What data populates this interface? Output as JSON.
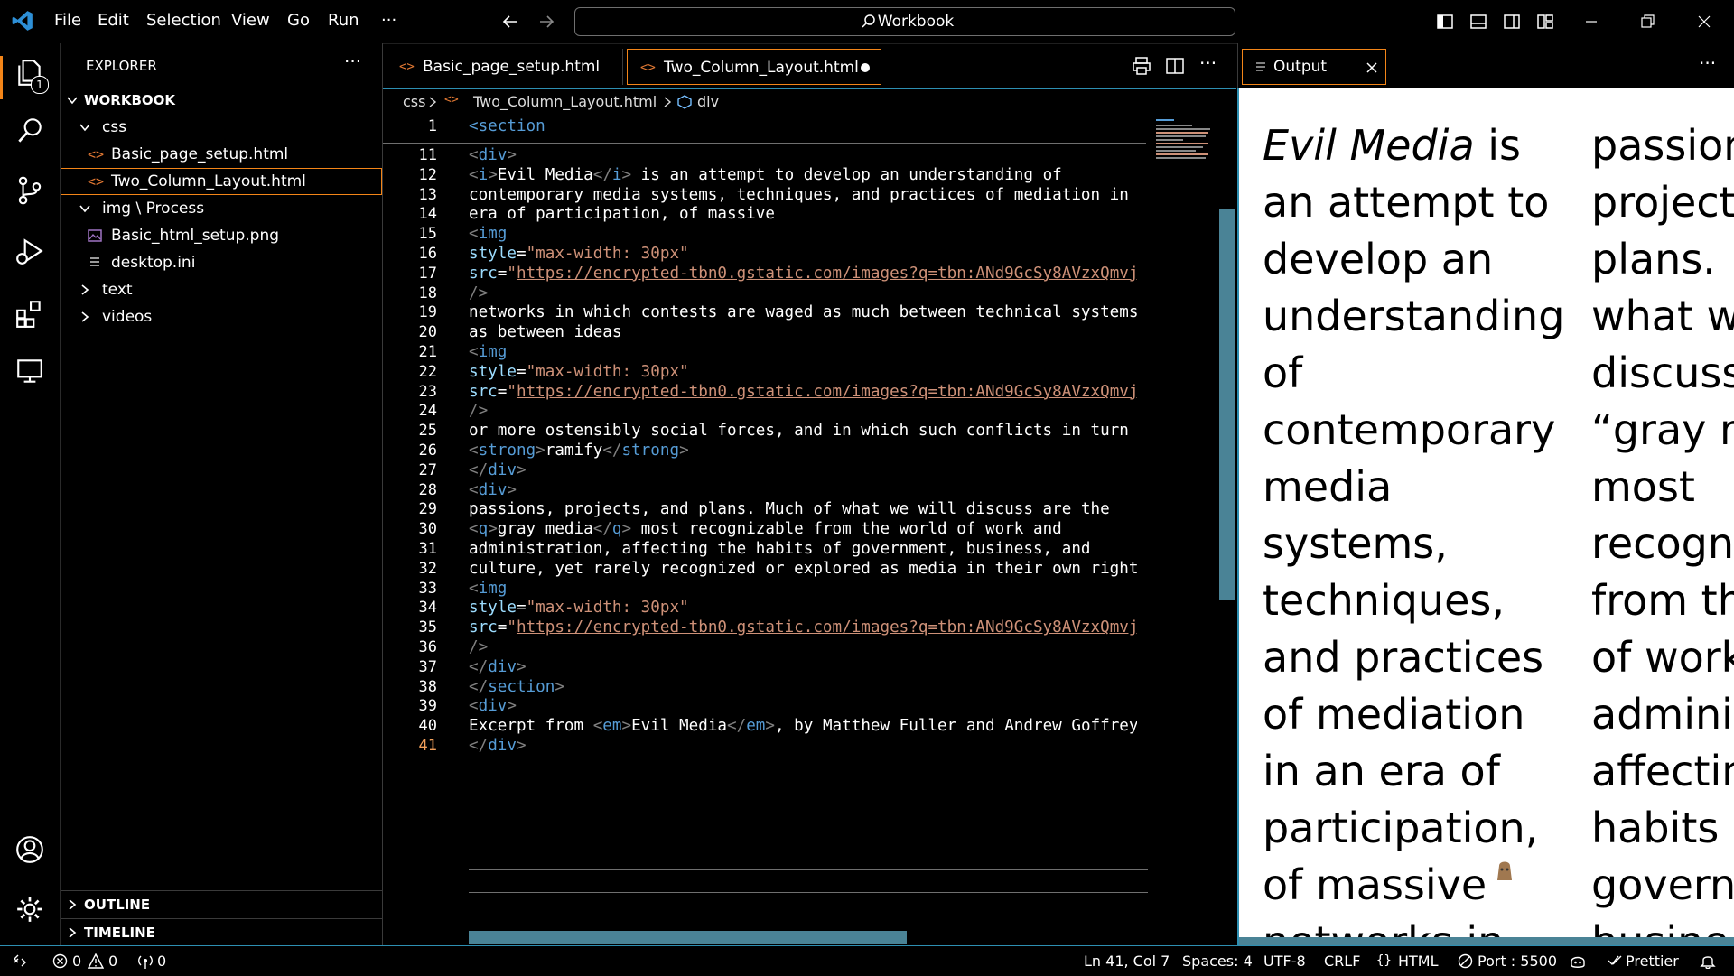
{
  "titlebar": {
    "menu": [
      "File",
      "Edit",
      "Selection",
      "View",
      "Go",
      "Run"
    ],
    "more": "···",
    "search_label": "Workbook"
  },
  "activity": {
    "explorer_badge": "1"
  },
  "sidebar": {
    "title": "EXPLORER",
    "more": "···",
    "workspace": "WORKBOOK",
    "tree": [
      {
        "label": "css",
        "kind": "folder-open",
        "depth": 1
      },
      {
        "label": "Basic_page_setup.html",
        "kind": "html",
        "depth": 2
      },
      {
        "label": "Two_Column_Layout.html",
        "kind": "html",
        "depth": 2,
        "selected": true
      },
      {
        "label": "img \\ Process",
        "kind": "folder-open",
        "depth": 1
      },
      {
        "label": "Basic_html_setup.png",
        "kind": "image",
        "depth": 2
      },
      {
        "label": "desktop.ini",
        "kind": "text-file",
        "depth": 2
      },
      {
        "label": "text",
        "kind": "folder-closed",
        "depth": 1
      },
      {
        "label": "videos",
        "kind": "folder-closed",
        "depth": 1
      }
    ],
    "outline": "OUTLINE",
    "timeline": "TIMELINE"
  },
  "tabs": [
    {
      "label": "Basic_page_setup.html",
      "active": false
    },
    {
      "label": "Two_Column_Layout.html",
      "active": true,
      "modified": true
    }
  ],
  "breadcrumb": [
    "css",
    "Two_Column_Layout.html",
    "div"
  ],
  "output": {
    "tab_label": "Output",
    "col1": [
      "Evil Media is",
      "an attempt to",
      "develop an",
      "understanding",
      "of",
      "contemporary",
      "media",
      "systems,",
      "techniques,",
      "and practices",
      "of mediation",
      "in an era of",
      "participation,",
      "of massive",
      "networks in"
    ],
    "col2": [
      "passion",
      "project",
      "plans.",
      "what w",
      "discuss",
      "“gray m",
      "most",
      "recogn",
      "from th",
      "of work",
      "admini",
      "affectin",
      "habits",
      "govern",
      "busine"
    ]
  },
  "status": {
    "errors": "0",
    "warnings": "0",
    "ports": "0",
    "position": "Ln 41, Col 7",
    "spaces": "Spaces: 4",
    "encoding": "UTF-8",
    "eol": "CRLF",
    "language": "HTML",
    "port": "Port : 5500",
    "prettier": "Prettier"
  },
  "code": {
    "sticky": {
      "num": "1",
      "text": "<section"
    },
    "lines": [
      {
        "num": "11",
        "text": "<div>"
      },
      {
        "num": "12",
        "text": "<i>Evil Media</i> is an attempt to develop an understanding of"
      },
      {
        "num": "13",
        "text": "contemporary media systems, techniques, and practices of mediation in an"
      },
      {
        "num": "14",
        "text": "era of participation, of massive"
      },
      {
        "num": "15",
        "text": "<img"
      },
      {
        "num": "16",
        "text": "style=\"max-width: 30px\""
      },
      {
        "num": "17",
        "text": "src=\"https://encrypted-tbn0.gstatic.com/images?q=tbn:ANd9GcSy8AVzxQmvj"
      },
      {
        "num": "18",
        "text": "/>"
      },
      {
        "num": "19",
        "text": "networks in which contests are waged as much between technical systems"
      },
      {
        "num": "20",
        "text": "as between ideas"
      },
      {
        "num": "21",
        "text": "<img"
      },
      {
        "num": "22",
        "text": "style=\"max-width: 30px\""
      },
      {
        "num": "23",
        "text": "src=\"https://encrypted-tbn0.gstatic.com/images?q=tbn:ANd9GcSy8AVzxQmvj"
      },
      {
        "num": "24",
        "text": "/>"
      },
      {
        "num": "25",
        "text": "or more ostensibly social forces, and in which such conflicts in turn"
      },
      {
        "num": "26",
        "text": "<strong>ramify</strong>"
      },
      {
        "num": "27",
        "text": "</div>"
      },
      {
        "num": "28",
        "text": "<div>"
      },
      {
        "num": "29",
        "text": "passions, projects, and plans. Much of what we will discuss are the"
      },
      {
        "num": "30",
        "text": "<q>gray media</q> most recognizable from the world of work and"
      },
      {
        "num": "31",
        "text": "administration, affecting the habits of government, business, and"
      },
      {
        "num": "32",
        "text": "culture, yet rarely recognized or explored as media in their own right"
      },
      {
        "num": "33",
        "text": "<img"
      },
      {
        "num": "34",
        "text": "style=\"max-width: 30px\""
      },
      {
        "num": "35",
        "text": "src=\"https://encrypted-tbn0.gstatic.com/images?q=tbn:ANd9GcSy8AVzxQmvj"
      },
      {
        "num": "36",
        "text": "/>"
      },
      {
        "num": "37",
        "text": "</div>"
      },
      {
        "num": "38",
        "text": "</section>"
      },
      {
        "num": "39",
        "text": "<div>"
      },
      {
        "num": "40",
        "text": "Excerpt from <em>Evil Media</em>, by Matthew Fuller and Andrew Goffrey"
      },
      {
        "num": "41",
        "text": "</div>"
      }
    ]
  },
  "colors": {
    "accent": "#2d8fb2",
    "selection_outline": "#f38518",
    "tag": "#569cd6",
    "string": "#ce9178",
    "attr": "#9cdcfe",
    "html_icon": "#e37933"
  }
}
